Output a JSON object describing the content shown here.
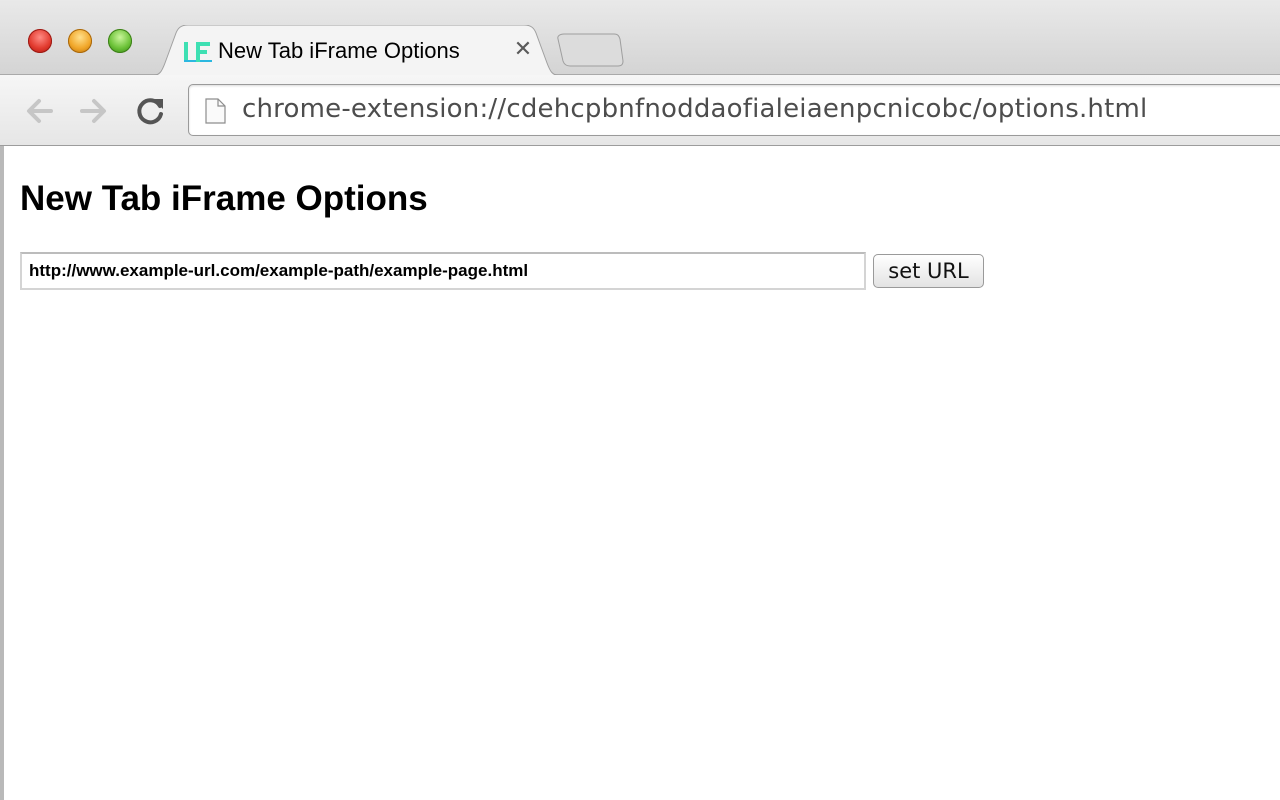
{
  "window": {
    "buttons": {
      "close": "close-window",
      "minimize": "minimize-window",
      "zoom": "zoom-window"
    }
  },
  "tab": {
    "title": "New Tab iFrame Options",
    "favicon_text": "IF",
    "close_glyph": "✕",
    "favicon_color": "#39d9a8"
  },
  "toolbar": {
    "url": "chrome-extension://cdehcpbnfnoddaofialeiaenpcnicobc/options.html"
  },
  "page": {
    "heading": "New Tab iFrame Options",
    "url_field_value": "http://www.example-url.com/example-path/example-page.html",
    "set_button_label": "set URL"
  },
  "icons": [
    "back-arrow-icon",
    "forward-arrow-icon",
    "reload-icon",
    "page-icon",
    "close-icon",
    "favicon-icon"
  ]
}
